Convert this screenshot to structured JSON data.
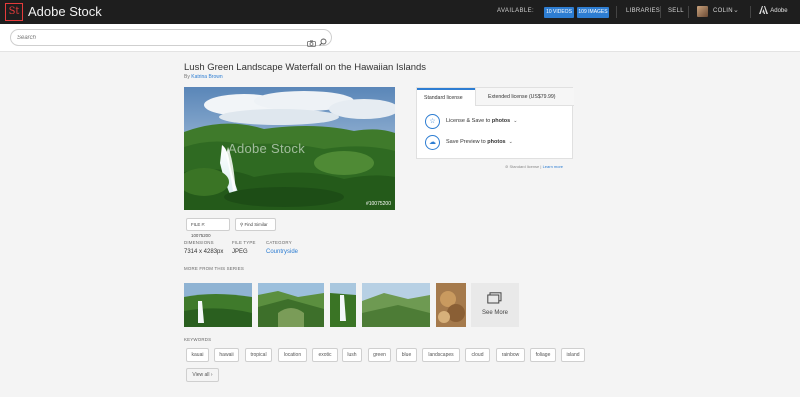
{
  "header": {
    "logo_text": "St",
    "brand": "Adobe Stock",
    "available_label": "AVAILABLE:",
    "videos_badge": "10 VIDEOS",
    "images_badge": "109 IMAGES",
    "libraries": "LIBRARIES",
    "sell": "SELL",
    "user": "COLIN",
    "adobe": "Adobe"
  },
  "search": {
    "placeholder": "Search"
  },
  "asset": {
    "title": "Lush Green Landscape Waterfall on the Hawaiian Islands",
    "by_prefix": "By",
    "author": "Katrina Brown",
    "image_id": "#10075200",
    "watermark": "Adobe Stock"
  },
  "license": {
    "tab_standard": "Standard license",
    "tab_extended": "Extended license (US$79.99)",
    "save_prefix": "License & Save to",
    "save_target": "photos",
    "preview_prefix": "Save Preview to",
    "preview_target": "photos",
    "note_prefix": "Standard license |",
    "note_link": "Learn more"
  },
  "file": {
    "file_label": "FILE #: 10075200",
    "find_similar": "Find Similar",
    "dimensions_label": "DIMENSIONS",
    "dimensions_value": "7314 x 4283px",
    "type_label": "FILE TYPE",
    "type_value": "JPEG",
    "category_label": "CATEGORY",
    "category_value": "Countryside"
  },
  "series": {
    "label": "MORE FROM THIS SERIES",
    "see_more": "See More"
  },
  "keywords": {
    "label": "KEYWORDS",
    "items": [
      "kauai",
      "hawaii",
      "tropical",
      "location",
      "exotic",
      "lush",
      "green",
      "blue",
      "landscapes",
      "cloud",
      "rainbow",
      "foliage",
      "island"
    ],
    "view_all": "View all ›"
  }
}
